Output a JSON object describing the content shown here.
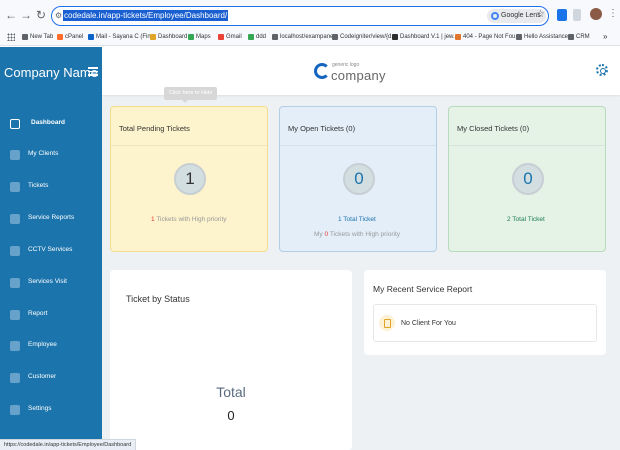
{
  "browser": {
    "url": "codedale.in/app-tickets/Employee/Dashboard/",
    "lens_label": "Google Lens",
    "status_url": "https://codedale.in/app-tickets/Employee/Dashboard",
    "bookmarks": [
      {
        "label": "New Tab",
        "icon": "tab-icon",
        "color": "#5f6368"
      },
      {
        "label": "cPanel",
        "icon": "cpanel-icon",
        "color": "#ff6c2c"
      },
      {
        "label": "Mail - Sayana C (Fin...",
        "icon": "outlook-icon",
        "color": "#0a64c8"
      },
      {
        "label": "Dashboard",
        "icon": "dashboard-icon",
        "color": "#e0a526"
      },
      {
        "label": "Maps",
        "icon": "maps-icon",
        "color": "#34a853"
      },
      {
        "label": "Gmail",
        "icon": "gmail-icon",
        "color": "#ea4335"
      },
      {
        "label": "ddd",
        "icon": "bookmark-icon",
        "color": "#34a853"
      },
      {
        "label": "localhost/exampane...",
        "icon": "page-icon",
        "color": "#5f6368"
      },
      {
        "label": "Codeigniter/view/{d...",
        "icon": "page-icon",
        "color": "#5f6368"
      },
      {
        "label": "Dashboard V.1 | jew...",
        "icon": "bookmark-icon",
        "color": "#2c2c2c"
      },
      {
        "label": "404 - Page Not Fou...",
        "icon": "bookmark-icon",
        "color": "#e0762c"
      },
      {
        "label": "Hello Assistance",
        "icon": "globe-icon",
        "color": "#5f6368"
      },
      {
        "label": "CRM",
        "icon": "crm-icon",
        "color": "#5f6368"
      }
    ]
  },
  "app": {
    "brand": "Company Name",
    "logo_tagline": "generic logo",
    "logo_name": "company",
    "tooltip": "Click here to Hide",
    "nav": [
      {
        "label": "Dashboard",
        "icon": "monitor-icon",
        "active": true
      },
      {
        "label": "My Clients",
        "icon": "clients-icon"
      },
      {
        "label": "Tickets",
        "icon": "tickets-icon"
      },
      {
        "label": "Service Reports",
        "icon": "reports-icon"
      },
      {
        "label": "CCTV Services",
        "icon": "camera-icon"
      },
      {
        "label": "Services Visit",
        "icon": "visit-icon"
      },
      {
        "label": "Report",
        "icon": "report-icon"
      },
      {
        "label": "Employee",
        "icon": "employee-icon"
      },
      {
        "label": "Customer",
        "icon": "customer-icon"
      },
      {
        "label": "Settings",
        "icon": "settings-icon"
      }
    ],
    "cards": {
      "pending": {
        "title": "Total Pending Tickets",
        "count": "1",
        "high_count": "1",
        "high_suffix": "Tickets with High priority"
      },
      "open": {
        "title": "My Open Tickets (0)",
        "count": "0",
        "total_line": "1 Total Ticket",
        "high_prefix": "My",
        "high_count": "0",
        "high_suffix": "Tickets with High priority"
      },
      "closed": {
        "title": "My Closed Tickets (0)",
        "count": "0",
        "total_line": "2 Total Ticket"
      }
    },
    "status_panel": {
      "title": "Ticket by Status",
      "total_label": "Total",
      "total_value": "0"
    },
    "report_panel": {
      "title": "My Recent Service Report",
      "empty_text": "No Client For You"
    }
  },
  "colors": {
    "sidebar": "#1c74ac",
    "accent": "#1c74ac",
    "danger": "#e53935",
    "success": "#1e7e53"
  }
}
